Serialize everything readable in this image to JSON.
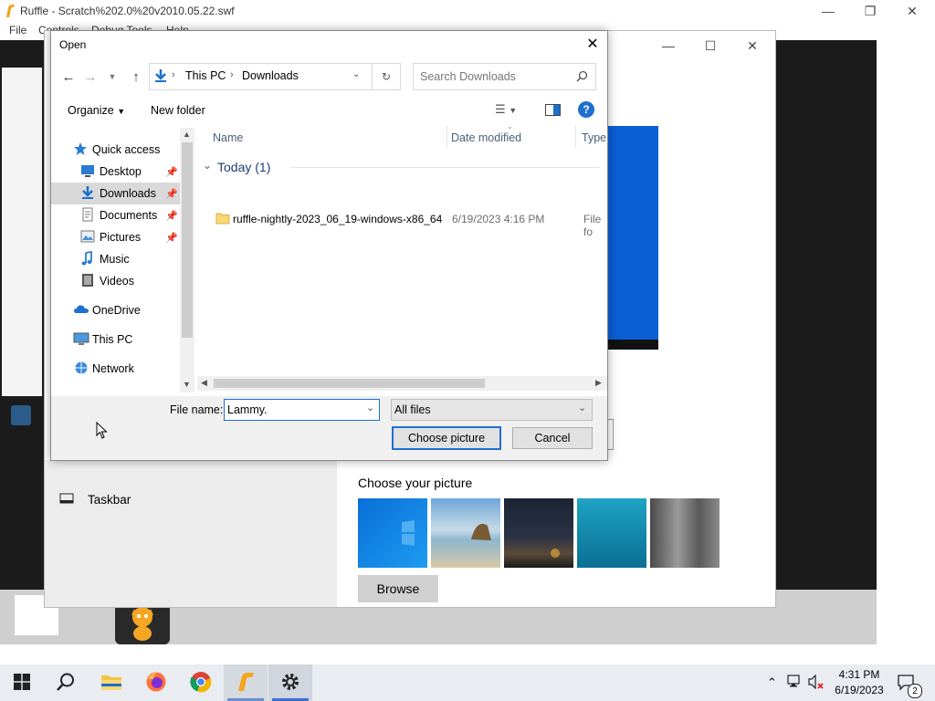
{
  "ruffle": {
    "title": "Ruffle - Scratch%202.0%20v2010.05.22.swf",
    "menu": [
      "File",
      "Controls",
      "Debug Tools",
      "Help"
    ]
  },
  "settings": {
    "taskbar_label": "Taskbar",
    "choose_picture_heading": "Choose your picture",
    "browse_label": "Browse"
  },
  "dialog": {
    "title": "Open",
    "address": {
      "crumbs": [
        "This PC",
        "Downloads"
      ]
    },
    "search": {
      "placeholder": "Search Downloads"
    },
    "toolbar": {
      "organize": "Organize",
      "new_folder": "New folder"
    },
    "nav": {
      "items": [
        {
          "label": "Quick access",
          "icon": "star-icon"
        },
        {
          "label": "Desktop",
          "icon": "desktop-icon",
          "pinned": true
        },
        {
          "label": "Downloads",
          "icon": "downloads-icon",
          "pinned": true,
          "selected": true
        },
        {
          "label": "Documents",
          "icon": "documents-icon",
          "pinned": true
        },
        {
          "label": "Pictures",
          "icon": "pictures-icon",
          "pinned": true
        },
        {
          "label": "Music",
          "icon": "music-icon"
        },
        {
          "label": "Videos",
          "icon": "videos-icon"
        },
        {
          "label": "OneDrive",
          "icon": "onedrive-icon"
        },
        {
          "label": "This PC",
          "icon": "this-pc-icon"
        },
        {
          "label": "Network",
          "icon": "network-icon"
        }
      ]
    },
    "columns": {
      "name": "Name",
      "date_modified": "Date modified",
      "type": "Type"
    },
    "groups": [
      {
        "label": "Today (1)",
        "files": [
          {
            "name": "ruffle-nightly-2023_06_19-windows-x86_64",
            "date": "6/19/2023 4:16 PM",
            "type": "File fo"
          }
        ]
      }
    ],
    "file_name_label": "File name:",
    "file_name_value": "Lammy.",
    "file_type": "All files",
    "choose_button": "Choose picture",
    "cancel_button": "Cancel"
  },
  "taskbar": {
    "time": "4:31 PM",
    "date": "6/19/2023",
    "notification_count": "2"
  },
  "colors": {
    "accent": "#0078d7",
    "selection": "#cce8ff",
    "taskbar": "#e9ecf1",
    "link_blue": "#1e4e9a"
  }
}
